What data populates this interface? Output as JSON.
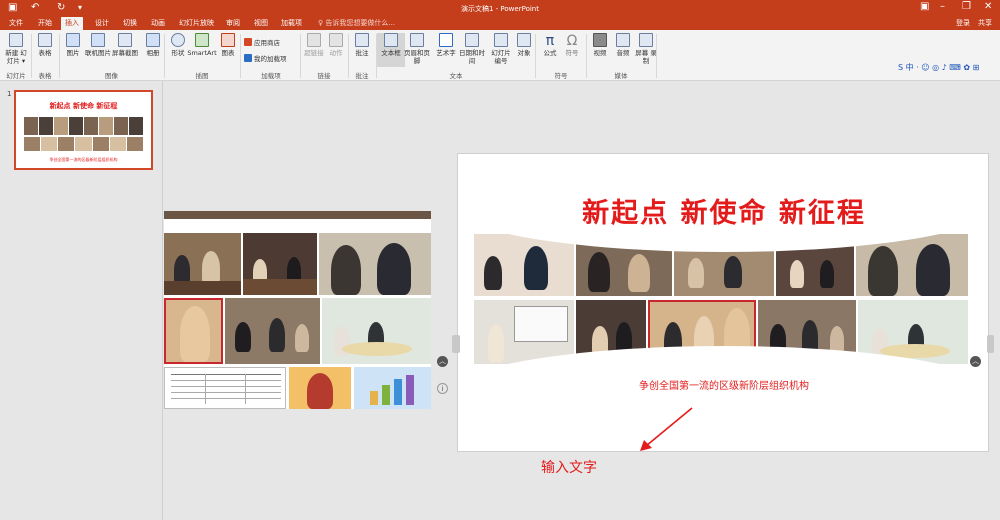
{
  "app": {
    "title": "演示文稿1 - PowerPoint",
    "quick_access": {
      "save_icon": "save-icon",
      "undo_icon": "undo-icon",
      "redo_icon": "redo-icon",
      "customize_icon": "customize-icon"
    }
  },
  "tabs": [
    "文件",
    "开始",
    "插入",
    "设计",
    "切换",
    "动画",
    "幻灯片放映",
    "审阅",
    "视图",
    "加载项"
  ],
  "active_tab": "插入",
  "tell_me": "♀ 告诉我您想要做什么...",
  "login": "登录",
  "share": "共享",
  "ime_toolbar": "S 中 · ☺ ◎ ♪ ⌨ ✿ ⊞",
  "ribbon": {
    "groups": [
      {
        "label": "幻灯片",
        "buttons": [
          "新建 幻灯片 ▾"
        ]
      },
      {
        "label": "表格",
        "buttons": [
          "表格"
        ]
      },
      {
        "label": "图像",
        "buttons": [
          "图片",
          "联机图片",
          "屏幕截图",
          "相册"
        ]
      },
      {
        "label": "插图",
        "buttons": [
          "形状",
          "SmartArt",
          "图表"
        ]
      },
      {
        "label": "加载项",
        "buttons": [
          "应用商店",
          "我的加载项"
        ]
      },
      {
        "label": "链接",
        "buttons": [
          "超链接",
          "动作"
        ]
      },
      {
        "label": "批注",
        "buttons": [
          "批注"
        ]
      },
      {
        "label": "文本",
        "buttons": [
          "文本框",
          "页眉和页脚",
          "艺术字",
          "日期和时间",
          "幻灯片 编号",
          "对象"
        ]
      },
      {
        "label": "符号",
        "buttons": [
          "公式",
          "符号"
        ]
      },
      {
        "label": "媒体",
        "buttons": [
          "视频",
          "音频",
          "屏幕 录制"
        ]
      }
    ]
  },
  "thumbnails": {
    "slide_number": "1",
    "title": "新起点 新使命 新征程",
    "subtitle": "争创全国第一流的区级新阶层组织机构"
  },
  "slide": {
    "title": "新起点 新使命 新征程",
    "subtitle": "争创全国第一流的区级新阶层组织机构"
  },
  "annotation": "输入文字",
  "colors": {
    "brand": "#c43e1c",
    "accent_red": "#e31b1b",
    "ribbon_bg": "#f3f3f3",
    "canvas_bg": "#e6e6e6"
  }
}
